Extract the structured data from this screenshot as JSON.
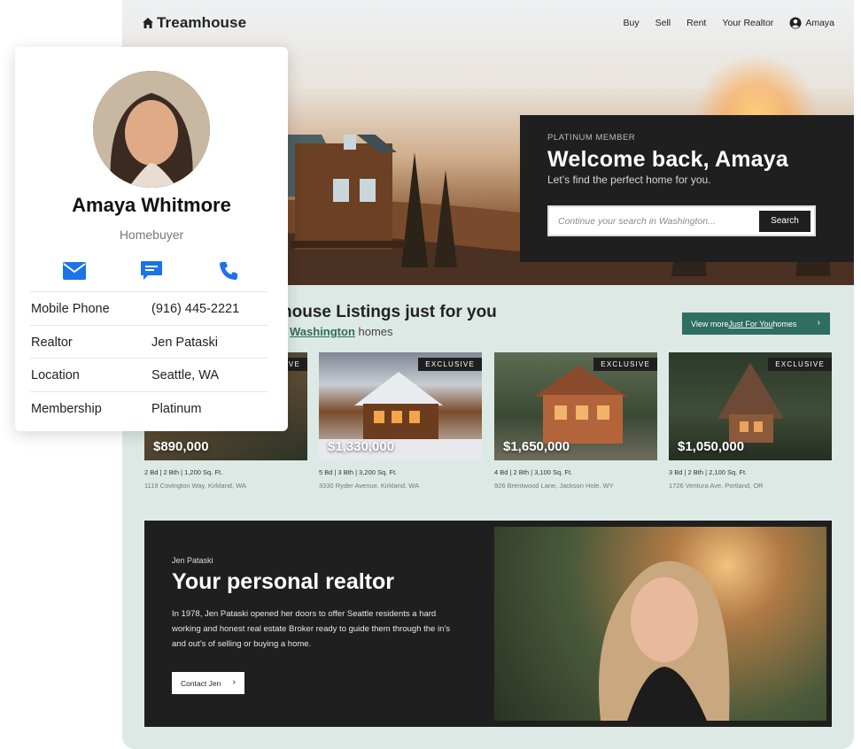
{
  "nav": {
    "logo": "Treamhouse",
    "links": [
      "Buy",
      "Sell",
      "Rent",
      "Your Realtor"
    ],
    "user": "Amaya"
  },
  "welcome": {
    "tier": "PLATINUM MEMBER",
    "title": "Welcome back, Amaya",
    "subtitle": "Let’s find the perfect home for you.",
    "search_placeholder": "Continue your search in Washington...",
    "search_button": "Search"
  },
  "listings": {
    "title": "house Listings just for you",
    "subtitle_location": "Washington",
    "subtitle_suffix": " homes",
    "view_more_prefix": "View more ",
    "view_more_link": "Just For You",
    "view_more_suffix": " homes",
    "cards": [
      {
        "price": "$890,000",
        "specs": "2 Bd  |  2 Bth  |  1,200 Sq. Ft.",
        "address": "1119 Covington Way, Kirkland, WA",
        "badge": "EXCLUSIVE"
      },
      {
        "price": "$1,330,000",
        "specs": "5 Bd  |  3 Bth  |  3,200 Sq. Ft.",
        "address": "3330 Ryder Avenue, Kirkland, WA",
        "badge": "EXCLUSIVE"
      },
      {
        "price": "$1,650,000",
        "specs": "4 Bd  |  2 Bth  |  3,100 Sq. Ft.",
        "address": "926 Brentwood Lane, Jackson Hole, WY",
        "badge": "EXCLUSIVE"
      },
      {
        "price": "$1,050,000",
        "specs": "3 Bd  |  2 Bth  |  2,100 Sq. Ft.",
        "address": "1726 Ventura Ave, Portland, OR",
        "badge": "EXCLUSIVE"
      }
    ]
  },
  "realtor": {
    "name": "Jen Pataski",
    "title": "Your personal realtor",
    "bio": "In 1978, Jen Pataski opened her doors to offer Seattle residents a hard working and honest real estate Broker ready to guide them through the in’s and out’s of selling or buying a home.",
    "contact_button": "Contact Jen"
  },
  "profile": {
    "name": "Amaya Whitmore",
    "role": "Homebuyer",
    "rows": [
      {
        "label": "Mobile Phone",
        "value": "(916) 445-2221"
      },
      {
        "label": "Realtor",
        "value": "Jen Pataski"
      },
      {
        "label": "Location",
        "value": "Seattle, WA"
      },
      {
        "label": "Membership",
        "value": "Platinum"
      }
    ]
  },
  "colors": {
    "accent": "#2f6e62",
    "icon_blue": "#1a73e8",
    "dark": "#1f1f1f",
    "page_bg": "#dde9e5"
  },
  "icons": [
    "home-icon",
    "user-circle-icon",
    "mail-icon",
    "chat-icon",
    "phone-icon",
    "chevron-right-icon"
  ]
}
